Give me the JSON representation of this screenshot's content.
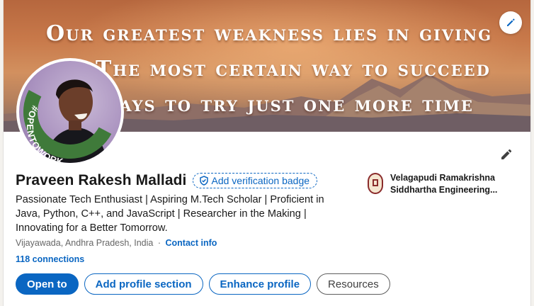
{
  "banner": {
    "quote_lines": [
      "Our greatest weakness lies in giving",
      "The most certain way to succeed",
      "ways to try just one more time"
    ]
  },
  "profile": {
    "name": "Praveen Rakesh Malladi",
    "verification_badge_label": "Add verification badge",
    "headline": "Passionate Tech Enthusiast | Aspiring M.Tech Scholar | Proficient in Java, Python, C++, and JavaScript | Researcher in the Making | Innovating for a Better Tomorrow.",
    "location": "Vijayawada, Andhra Pradesh, India",
    "separator": "·",
    "contact_info_label": "Contact info",
    "connections_label": "118 connections",
    "open_to_work_frame": "#OPENTOWORK"
  },
  "education": {
    "school_name_line1": "Velagapudi Ramakrishna",
    "school_name_line2": "Siddhartha Engineering..."
  },
  "actions": {
    "open_to": "Open to",
    "add_section": "Add profile section",
    "enhance": "Enhance profile",
    "resources": "Resources"
  },
  "colors": {
    "accent": "#0a66c2",
    "open_to_work_green": "#3f7a3a"
  },
  "icons": {
    "edit_banner": "pencil-icon",
    "edit_profile": "pencil-icon",
    "verify": "shield-check-icon"
  }
}
